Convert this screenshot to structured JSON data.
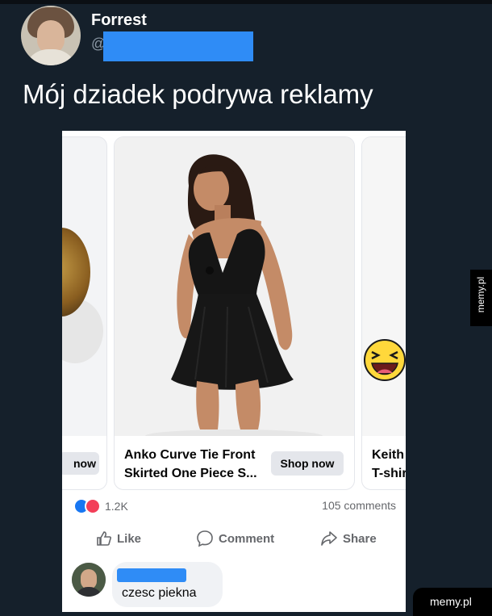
{
  "tweet": {
    "name": "Forrest",
    "handle_prefix": "@",
    "text": "Mój dziadek podrywa reklamy"
  },
  "ad": {
    "left_item": {
      "button_label": "now"
    },
    "main_item": {
      "title_line1": "Anko Curve Tie Front",
      "title_line2": "Skirted One Piece S...",
      "button_label": "Shop now"
    },
    "right_item": {
      "title_line1": "Keith",
      "title_line2": "T-shir"
    },
    "reaction_count": "1.2K",
    "comments_count": "105 comments",
    "actions": {
      "like": "Like",
      "comment": "Comment",
      "share": "Share"
    },
    "comment_text": "czesc piekna"
  },
  "watermarks": {
    "side": "memy.pl",
    "bottom": "memy.pl"
  },
  "colors": {
    "background": "#15202b",
    "redaction": "#2f8cf6",
    "like": "#1877f2",
    "love": "#f33e58",
    "button_gray": "#e4e6eb",
    "muted_text": "#65676b"
  }
}
